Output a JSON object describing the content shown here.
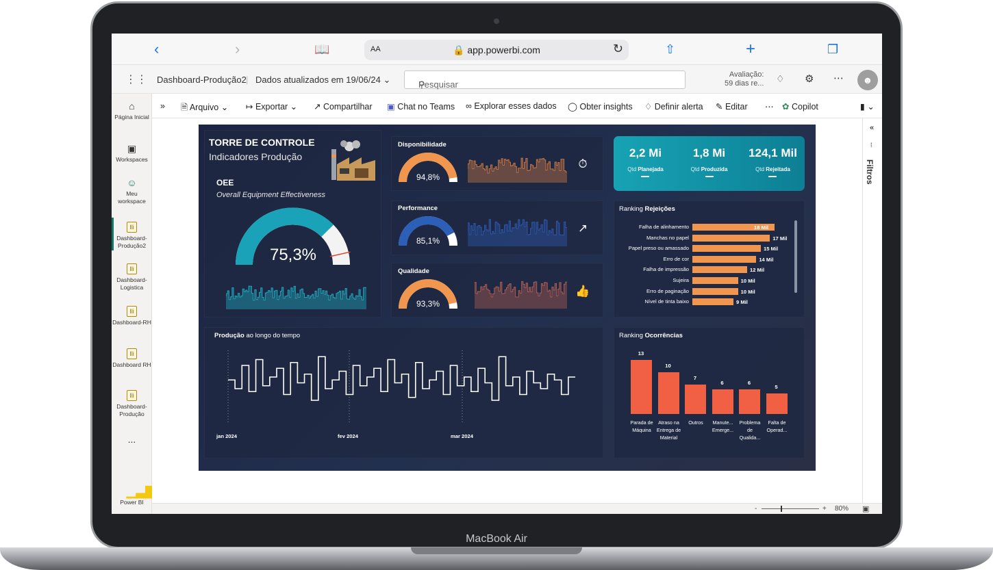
{
  "device": {
    "label": "MacBook Air"
  },
  "browser": {
    "url_display": "app.powerbi.com",
    "aa_label": "AA"
  },
  "powerbi": {
    "report_name": "Dashboard-Produção2",
    "refresh_text": "Dados atualizados em 19/06/24",
    "search_placeholder": "Pesquisar",
    "trial_line1": "Avaliação:",
    "trial_line2": "59 dias re...",
    "toolbar": [
      "Arquivo",
      "Exportar",
      "Compartilhar",
      "Chat no Teams",
      "Explorar esses dados",
      "Obter insights",
      "Definir alerta",
      "Editar",
      "Copilot"
    ],
    "nav": [
      {
        "label": "Página Inicial",
        "icon": "home-icon"
      },
      {
        "label": "Workspaces",
        "icon": "workspaces-icon"
      },
      {
        "label": "Meu workspace",
        "icon": "person-icon"
      },
      {
        "label": "Dashboard-Produção2",
        "icon": "report-icon"
      },
      {
        "label": "Dashboard-Logistica",
        "icon": "report-icon"
      },
      {
        "label": "Dashboard-RH",
        "icon": "report-icon"
      },
      {
        "label": "Dashboard RH",
        "icon": "report-icon"
      },
      {
        "label": "Dashboard-Produção",
        "icon": "report-icon"
      }
    ],
    "nav_more": "...",
    "app_label": "Power BI",
    "filters_label": "Filtros",
    "zoom": "80%"
  },
  "dashboard": {
    "title": "TORRE DE CONTROLE",
    "subtitle": "Indicadores Produção",
    "oee": {
      "label": "OEE",
      "desc": "Overall Equipment Effectiveness",
      "value_text": "75,3%",
      "value": 0.753
    },
    "gauges": [
      {
        "label": "Disponibilidade",
        "value_text": "94,8%",
        "value": 0.948,
        "color": "#f0964e",
        "spark_color": "#c27444",
        "badge_color": "#f0964e",
        "icon": "stopwatch-icon"
      },
      {
        "label": "Performance",
        "value_text": "85,1%",
        "value": 0.851,
        "color": "#2c5fb8",
        "spark_color": "#2d56a8",
        "badge_color": "#2c6fd1",
        "icon": "trend-up-icon"
      },
      {
        "label": "Qualidade",
        "value_text": "93,3%",
        "value": 0.933,
        "color": "#f0964e",
        "spark_color": "#a85c52",
        "badge_color": "#f26044",
        "icon": "thumbs-up-icon"
      }
    ],
    "kpis": [
      {
        "value": "2,2 Mi",
        "pre": "Qtd ",
        "label": "Planejada"
      },
      {
        "value": "1,8 Mi",
        "pre": "Qtd ",
        "label": "Produzida"
      },
      {
        "value": "124,1 Mil",
        "pre": "Qtd ",
        "label": "Rejeitada"
      }
    ],
    "rejections": {
      "title_pre": "Ranking ",
      "title_bold": "Rejeições",
      "items": [
        {
          "label": "Falha de alinhamento",
          "value": 18,
          "text": "18 Mil"
        },
        {
          "label": "Manchas no papel",
          "value": 17,
          "text": "17 Mil"
        },
        {
          "label": "Papel preso ou amassado",
          "value": 15,
          "text": "15 Mil"
        },
        {
          "label": "Erro de cor",
          "value": 14,
          "text": "14 Mil"
        },
        {
          "label": "Falha de impressão",
          "value": 12,
          "text": "12 Mil"
        },
        {
          "label": "Sujeira",
          "value": 10,
          "text": "10 Mil"
        },
        {
          "label": "Erro de paginação",
          "value": 10,
          "text": "10 Mil"
        },
        {
          "label": "Nível de tinta baixo",
          "value": 9,
          "text": "9 Mil"
        }
      ]
    },
    "occurrences": {
      "title_pre": "Ranking ",
      "title_bold": "Ocorrências",
      "items": [
        {
          "label": "Parada de Máquina",
          "value": 13
        },
        {
          "label": "Atraso na Entrega de Material",
          "value": 10
        },
        {
          "label": "Outros",
          "value": 7
        },
        {
          "label": "Manute... Emerge...",
          "value": 6
        },
        {
          "label": "Problema de Qualida...",
          "value": 6
        },
        {
          "label": "Falta de Operad...",
          "value": 5
        }
      ]
    },
    "production": {
      "title_bold": "Produção",
      "title_rest": " ao longo do tempo",
      "x_ticks": [
        "jan 2024",
        "fev 2024",
        "mar 2024"
      ]
    }
  },
  "chart_data": [
    {
      "type": "bar",
      "title": "Ranking Rejeições",
      "categories": [
        "Falha de alinhamento",
        "Manchas no papel",
        "Papel preso ou amassado",
        "Erro de cor",
        "Falha de impressão",
        "Sujeira",
        "Erro de paginação",
        "Nível de tinta baixo"
      ],
      "values": [
        18,
        17,
        15,
        14,
        12,
        10,
        10,
        9
      ]
    },
    {
      "type": "bar",
      "title": "Ranking Ocorrências",
      "categories": [
        "Parada de Máquina",
        "Atraso na Entrega de Material",
        "Outros",
        "Manute... Emerge...",
        "Problema de Qualida...",
        "Falta de Operad..."
      ],
      "values": [
        13,
        10,
        7,
        6,
        6,
        5
      ]
    },
    {
      "type": "line",
      "title": "Produção ao longo do tempo",
      "x": [
        "jan 2024",
        "fev 2024",
        "mar 2024"
      ],
      "values": [
        0.55,
        0.4,
        0.8,
        0.35,
        0.9,
        0.45,
        0.6,
        0.75,
        0.3,
        0.85,
        0.5,
        0.65,
        0.2,
        0.95,
        0.4,
        0.55,
        0.7,
        0.3,
        0.8,
        0.45,
        0.6,
        0.75,
        0.35,
        0.9,
        0.5,
        0.65,
        0.25,
        0.85,
        0.4,
        0.55,
        0.7,
        0.3,
        0.8,
        0.45,
        0.6,
        0.35,
        0.75,
        0.5,
        0.2,
        0.95,
        0.45,
        0.6,
        0.3,
        0.7,
        0.5,
        0.4,
        0.65,
        0.55,
        0.3,
        0.6
      ]
    }
  ]
}
